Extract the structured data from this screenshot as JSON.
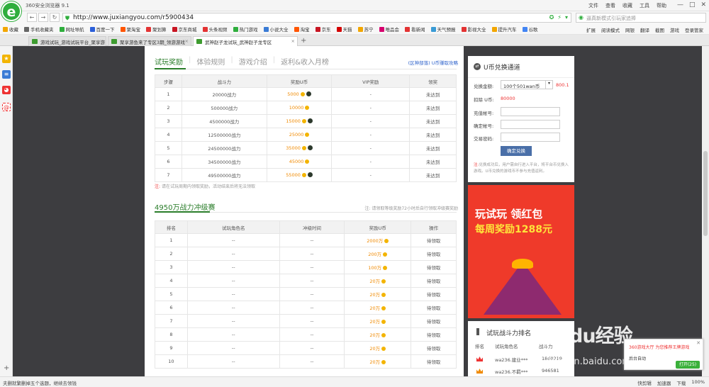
{
  "app": {
    "logo": "e",
    "title": "360安全浏览器 9.1"
  },
  "menus": [
    "文件",
    "查看",
    "收藏",
    "工具",
    "帮助"
  ],
  "window_controls": [
    "—",
    "□",
    "✕"
  ],
  "nav": {
    "back": "←",
    "forward": "→",
    "refresh": "↻",
    "url": "http://www.juxiangyou.com/r5900434",
    "search_placeholder": "逼真新模式引玩家追捧"
  },
  "bookmarks": [
    {
      "label": "收藏",
      "color": "#f2a600"
    },
    {
      "label": "手机收藏夹",
      "color": "#666666"
    },
    {
      "label": "网址导航",
      "color": "#2fae3d"
    },
    {
      "label": "百度一下",
      "color": "#2b5fd9"
    },
    {
      "label": "聚淘宝",
      "color": "#ff5500"
    },
    {
      "label": "聚划算",
      "color": "#e33333"
    },
    {
      "label": "京东商城",
      "color": "#c81623"
    },
    {
      "label": "头条视频",
      "color": "#e33333"
    },
    {
      "label": "热门游戏",
      "color": "#2fae3d"
    },
    {
      "label": "小说大全",
      "color": "#3a7bd5"
    },
    {
      "label": "淘宝",
      "color": "#ff5500"
    },
    {
      "label": "京东",
      "color": "#c81623"
    },
    {
      "label": "天猫",
      "color": "#d40000"
    },
    {
      "label": "苏宁",
      "color": "#f2a600"
    },
    {
      "label": "唯品会",
      "color": "#d6006e"
    },
    {
      "label": "看新闻",
      "color": "#e33333"
    },
    {
      "label": "天气预报",
      "color": "#3a9bd5"
    },
    {
      "label": "影视大全",
      "color": "#e33333"
    },
    {
      "label": "提升汽车",
      "color": "#f2a600"
    },
    {
      "label": "谷歌",
      "color": "#4285f4"
    }
  ],
  "toolbar_right": [
    "扩展",
    "阅读模式",
    "网银",
    "翻译",
    "截图",
    "游戏",
    "登录管家"
  ],
  "tabs": [
    {
      "label": "游戏试玩_游戏试玩平台_聚享游",
      "active": false
    },
    {
      "label": "聚享游鱼来了专区3期_领游游戏",
      "active": false
    },
    {
      "label": "武神赵子龙试玩_武神赵子龙专区",
      "active": true
    }
  ],
  "newtab": "+",
  "main": {
    "tabs": [
      "试玩奖励",
      "体验规则",
      "游戏介绍",
      "返利&收入月榜"
    ],
    "top_link": "(区神部落) U币赚取攻略",
    "reward_table": {
      "headers": [
        "步骤",
        "战斗力",
        "奖励U币",
        "VIP奖励",
        "领奖"
      ],
      "rows": [
        {
          "step": "1",
          "power": "20000战力",
          "reward": "5000",
          "vip": "-",
          "status": "未达到",
          "green": true
        },
        {
          "step": "2",
          "power": "500000战力",
          "reward": "10000",
          "vip": "-",
          "status": "未达到",
          "green": false
        },
        {
          "step": "3",
          "power": "4500000战力",
          "reward": "15000",
          "vip": "-",
          "status": "未达到",
          "green": true
        },
        {
          "step": "4",
          "power": "12500000战力",
          "reward": "25000",
          "vip": "-",
          "status": "未达到",
          "green": false
        },
        {
          "step": "5",
          "power": "24500000战力",
          "reward": "35000",
          "vip": "-",
          "status": "未达到",
          "green": true
        },
        {
          "step": "6",
          "power": "34500000战力",
          "reward": "45000",
          "vip": "-",
          "status": "未达到",
          "green": false
        },
        {
          "step": "7",
          "power": "49500000战力",
          "reward": "55000",
          "vip": "-",
          "status": "未达到",
          "green": true
        }
      ]
    },
    "reward_note_prefix": "注:",
    "reward_note": "请在试玩周期内领取奖励，活动结束后将无法领取",
    "section2_title": "4950万战力冲级赛",
    "section2_note": "注: 请领取等级奖励72小时后自行领取冲级赛奖励",
    "rank_table": {
      "headers": [
        "排名",
        "试玩角色名",
        "冲级时间",
        "奖励U币",
        "操作"
      ],
      "rows": [
        {
          "rank": "1",
          "name": "--",
          "time": "--",
          "reward": "2000万",
          "op": "待领取"
        },
        {
          "rank": "2",
          "name": "--",
          "time": "--",
          "reward": "200万",
          "op": "待领取"
        },
        {
          "rank": "3",
          "name": "--",
          "time": "--",
          "reward": "100万",
          "op": "待领取"
        },
        {
          "rank": "4",
          "name": "--",
          "time": "--",
          "reward": "20万",
          "op": "待领取"
        },
        {
          "rank": "5",
          "name": "--",
          "time": "--",
          "reward": "20万",
          "op": "待领取"
        },
        {
          "rank": "6",
          "name": "--",
          "time": "--",
          "reward": "20万",
          "op": "待领取"
        },
        {
          "rank": "7",
          "name": "--",
          "time": "--",
          "reward": "20万",
          "op": "待领取"
        },
        {
          "rank": "8",
          "name": "--",
          "time": "--",
          "reward": "20万",
          "op": "待领取"
        },
        {
          "rank": "9",
          "name": "--",
          "time": "--",
          "reward": "20万",
          "op": "待领取"
        },
        {
          "rank": "10",
          "name": "--",
          "time": "--",
          "reward": "20万",
          "op": "待领取"
        }
      ]
    }
  },
  "exchange": {
    "title": "U币兑换通道",
    "amount_label": "兑换金额:",
    "amount_value": "100个501wan币",
    "amount_side": "800.1",
    "deduct_label": "扣除 U币:",
    "deduct_value": "80000",
    "account_label": "充值帐号:",
    "confirm_label": "确定帐号:",
    "password_label": "交易密码:",
    "button": "确定兑换",
    "note_prefix": "注:",
    "note": "兑换成功后，用户需自行进入平台，将平台币兑换入游戏。U币兑换的游戏币不参与充值返利。"
  },
  "banner": {
    "line1": "玩试玩 领红包",
    "line2": "每周奖励1288元"
  },
  "ranking": {
    "title": "试玩战斗力排名",
    "headers": [
      "排名",
      "试玩角色名",
      "战斗力"
    ],
    "rows": [
      {
        "name": "wa236.建业***",
        "score": "18d0219"
      },
      {
        "name": "wa236.不羁***",
        "score": "946581"
      }
    ]
  },
  "watermark": {
    "line1": "Baidu经验",
    "line2": "jingyan.baidu.com"
  },
  "popup": {
    "line1": "360游戏大厅 为您推荐王牌游戏",
    "line2": "后台自动",
    "button": "打开(25)",
    "close": "✕"
  },
  "status": {
    "text": "夫删就繁删掉五个选题，继续去领钱",
    "right": [
      "快剪辑",
      "加速器",
      "下载",
      "100%"
    ]
  }
}
